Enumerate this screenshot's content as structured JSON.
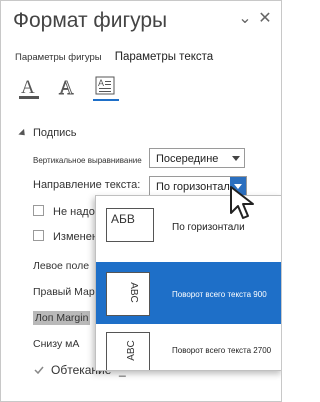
{
  "header": {
    "title": "Формат фигуры",
    "collapse_glyph": "⌄",
    "close_glyph": "✕"
  },
  "tabs": [
    {
      "label": "Параметры фигуры"
    },
    {
      "label": "Параметры текста"
    }
  ],
  "icon_tabs": [
    {
      "icon": "text-fill-icon",
      "label": "A"
    },
    {
      "icon": "text-outline-icon",
      "label": "A"
    },
    {
      "icon": "textbox-icon",
      "label": "A"
    }
  ],
  "section": {
    "title": "Подпись"
  },
  "vertical_alignment": {
    "label": "Вертикальное выравнивание",
    "value": "Посередине"
  },
  "text_direction": {
    "label": "Направление текста:",
    "value": "По горизонтали"
  },
  "checkboxes": [
    {
      "label": "Не надо"
    },
    {
      "label": "Изменение размера s"
    }
  ],
  "fields": [
    {
      "label": "Левое поле"
    },
    {
      "label": "Правый Марг"
    },
    {
      "label": "Лоп Margin"
    },
    {
      "label": "Снизу мА"
    }
  ],
  "wrap": {
    "label": "Обтекание \"_\""
  },
  "direction_options": [
    {
      "label": "По горизонтали",
      "sample": "АБВ",
      "selected": false
    },
    {
      "label": "Поворот всего текста 900",
      "sample": "ABC",
      "selected": true
    },
    {
      "label": "Поворот всего текста 2700",
      "sample": "ABC",
      "selected": false
    }
  ],
  "colors": {
    "accent": "#1e6fc8",
    "dropdown_active": "#2b6fbf",
    "highlight": "#b9b9b9"
  }
}
